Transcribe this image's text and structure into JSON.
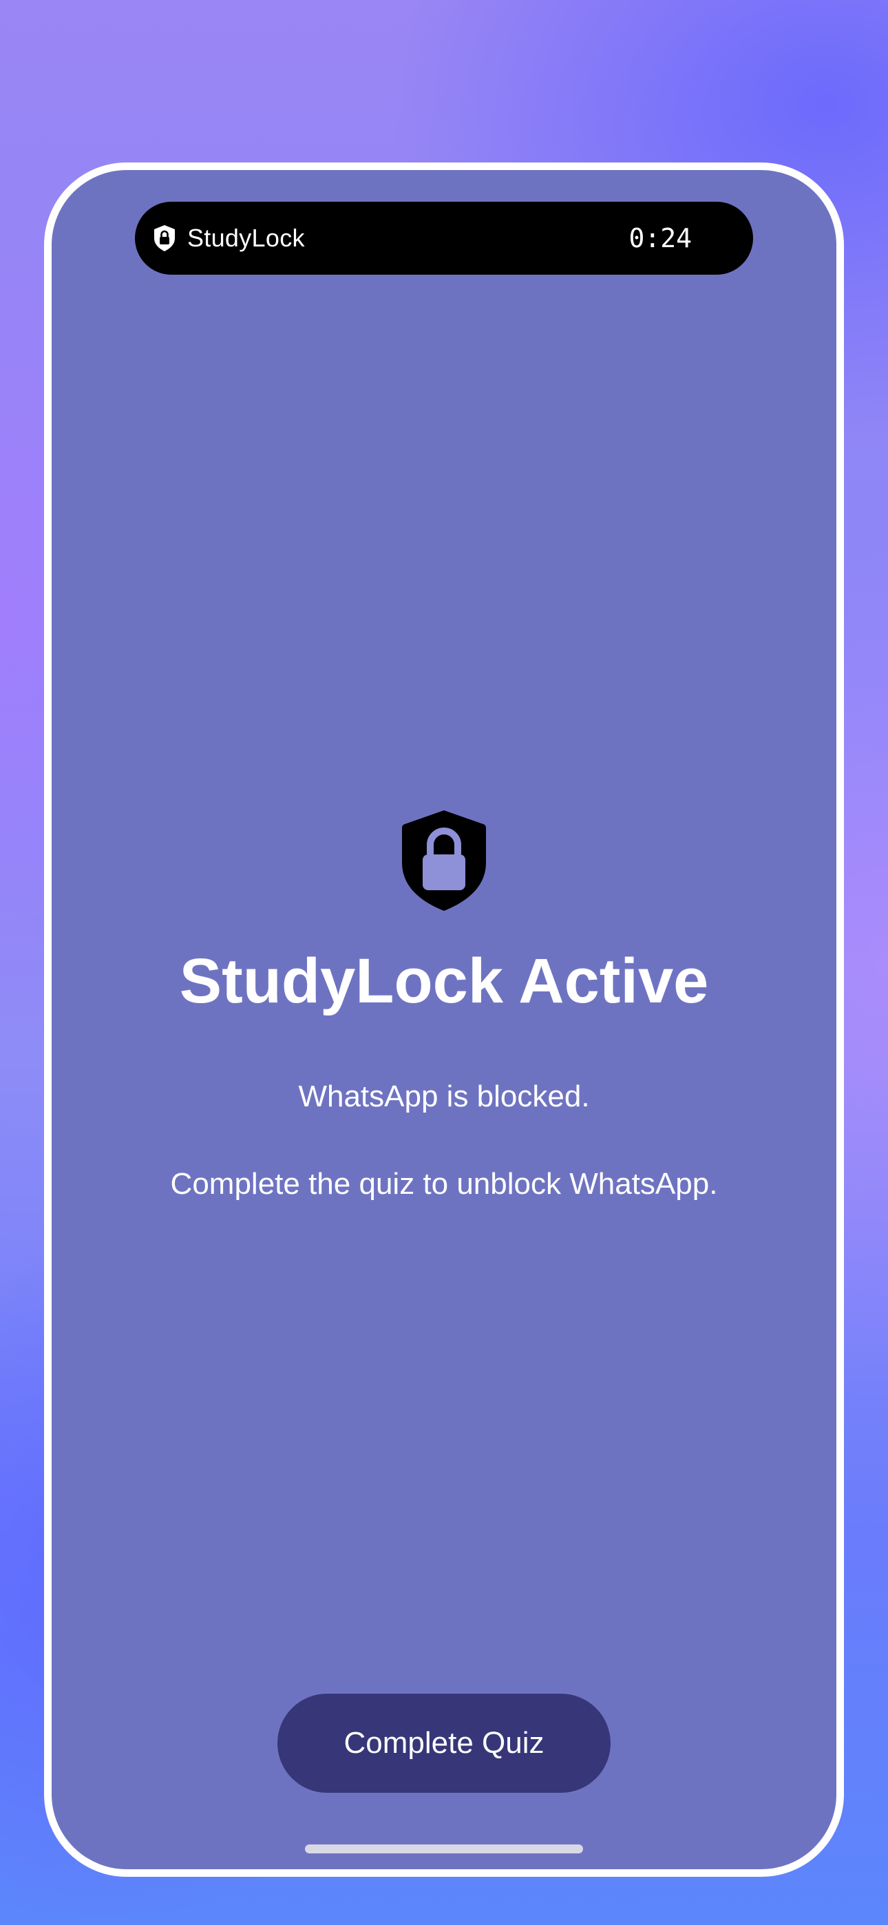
{
  "island": {
    "icon": "shield-lock-icon",
    "app_name": "StudyLock",
    "timer": "0:24"
  },
  "block_screen": {
    "icon": "shield-lock-icon",
    "title": "StudyLock Active",
    "message": "WhatsApp is blocked.",
    "instruction": "Complete the quiz to unblock WhatsApp.",
    "button_label": "Complete Quiz"
  },
  "colors": {
    "screen_background": "#6e73c1",
    "button_background": "#363678",
    "text": "#ffffff",
    "island": "#000000"
  }
}
